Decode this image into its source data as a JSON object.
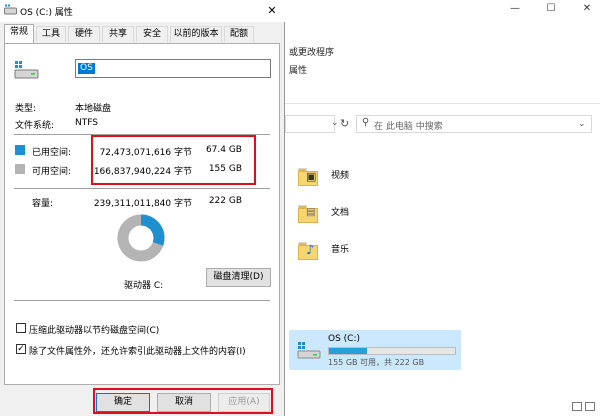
{
  "explorer": {
    "ribbon_items": [
      "或更改程序",
      "属性"
    ],
    "search_placeholder": "在 此电脑 中搜索",
    "folders": [
      {
        "label": "视频",
        "icon": "video-folder-icon"
      },
      {
        "label": "文档",
        "icon": "documents-folder-icon"
      },
      {
        "label": "音乐",
        "icon": "music-folder-icon"
      }
    ],
    "drive": {
      "name": "OS (C:)",
      "free_text": "155 GB 可用，共 222 GB",
      "used_fraction": 0.3
    }
  },
  "dialog": {
    "title": "OS (C:) 属性",
    "close_symbol": "✕",
    "tabs": [
      "常规",
      "工具",
      "硬件",
      "共享",
      "安全",
      "以前的版本",
      "配额"
    ],
    "active_tab": "常规",
    "drive_name_value": "OS",
    "type_label": "类型:",
    "type_value": "本地磁盘",
    "fs_label": "文件系统:",
    "fs_value": "NTFS",
    "used": {
      "label": "已用空间:",
      "bytes": "72,473,071,616 字节",
      "size": "67.4 GB",
      "color": "#1e90d0"
    },
    "free": {
      "label": "可用空间:",
      "bytes": "166,837,940,224 字节",
      "size": "155 GB",
      "color": "#b4b4b4"
    },
    "capacity": {
      "label": "容量:",
      "bytes": "239,311,011,840 字节",
      "size": "222 GB"
    },
    "used_fraction": 0.303,
    "drive_letter_label": "驱动器 C:",
    "cleanup_button": "磁盘清理(D)",
    "compress_label": "压缩此驱动器以节约磁盘空间(C)",
    "compress_checked": false,
    "index_label": "除了文件属性外，还允许索引此驱动器上文件的内容(I)",
    "index_checked": true,
    "ok_button": "确定",
    "cancel_button": "取消",
    "apply_button": "应用(A)"
  }
}
